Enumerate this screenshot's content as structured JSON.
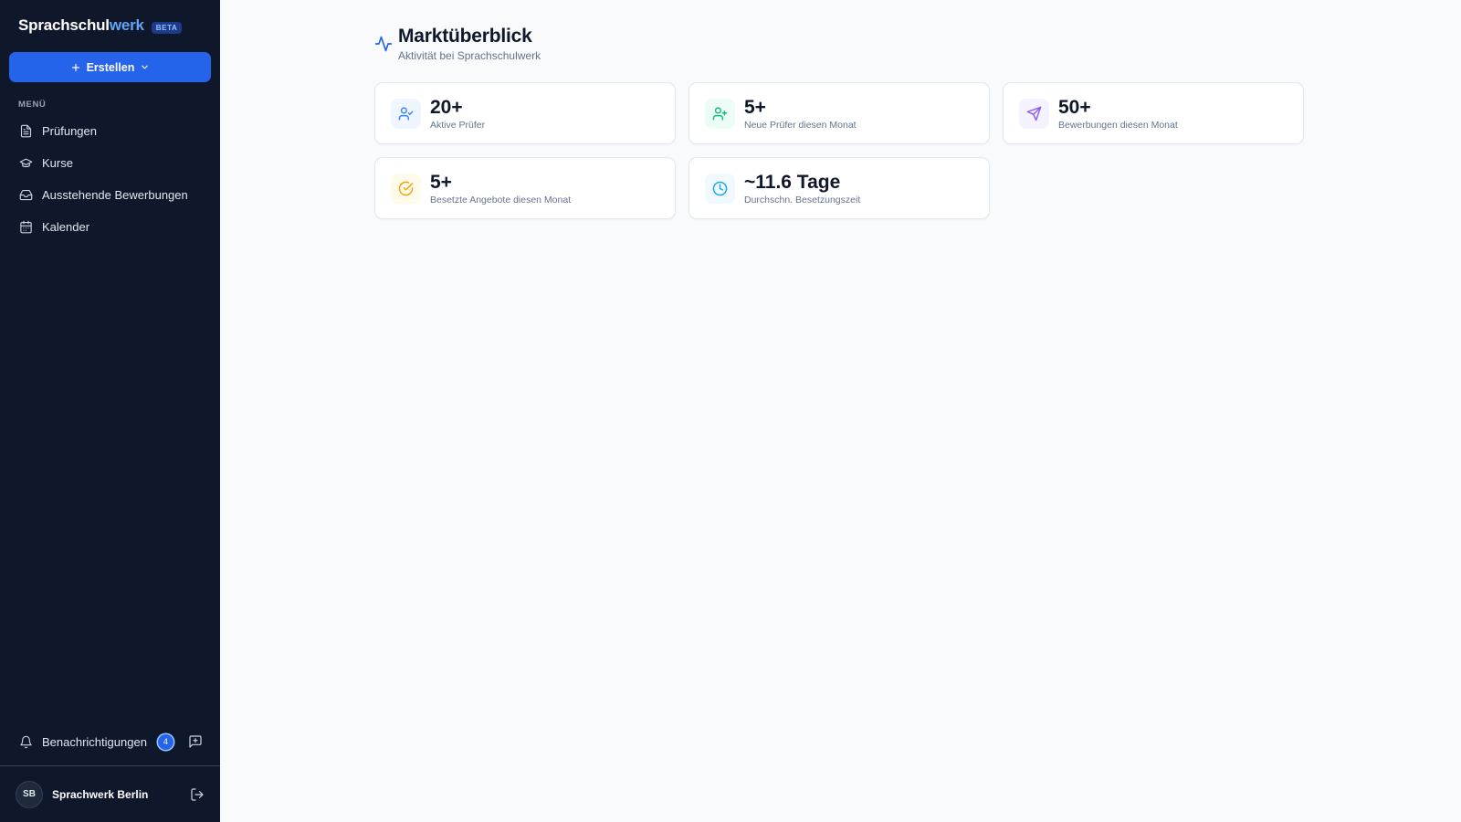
{
  "brand": {
    "name_part1": "Sprachschul",
    "name_part2": "werk",
    "badge": "BETA"
  },
  "create_button": {
    "label": "Erstellen",
    "icon": "plus-icon",
    "caret_icon": "chevron-down-icon"
  },
  "menu": {
    "title": "MENÜ",
    "items": [
      {
        "label": "Prüfungen",
        "icon": "file-text-icon"
      },
      {
        "label": "Kurse",
        "icon": "graduation-cap-icon"
      },
      {
        "label": "Ausstehende Bewerbungen",
        "icon": "inbox-icon"
      },
      {
        "label": "Kalender",
        "icon": "calendar-icon"
      }
    ]
  },
  "notifications": {
    "label": "Benachrichtigungen",
    "count": "4",
    "icon": "bell-icon",
    "feedback_icon": "message-square-plus-icon"
  },
  "user": {
    "initials": "SB",
    "name": "Sprachwerk Berlin",
    "logout_icon": "log-out-icon"
  },
  "header": {
    "title": "Marktüberblick",
    "subtitle": "Aktivität bei Sprachschulwerk",
    "icon": "activity-icon"
  },
  "stats": [
    {
      "value": "20+",
      "label": "Aktive Prüfer",
      "icon": "user-check-icon",
      "color": "#3b82f6",
      "bg": "#eff6ff"
    },
    {
      "value": "5+",
      "label": "Neue Prüfer diesen Monat",
      "icon": "user-plus-icon",
      "color": "#10b981",
      "bg": "#ecfdf5"
    },
    {
      "value": "50+",
      "label": "Bewerbungen diesen Monat",
      "icon": "send-icon",
      "color": "#8b5cf6",
      "bg": "#f5f3ff"
    },
    {
      "value": "5+",
      "label": "Besetzte Angebote diesen Monat",
      "icon": "circle-check-icon",
      "color": "#f59e0b",
      "bg": "#fffbeb"
    },
    {
      "value": "~11.6 Tage",
      "label": "Durchschn. Besetzungszeit",
      "icon": "clock-icon",
      "color": "#0ea5e9",
      "bg": "#f0f9ff"
    }
  ],
  "colors": {
    "sidebar": "#0f172a",
    "accent": "#2563eb",
    "brand_accent": "#60a5fa",
    "background": "#f8fafc"
  }
}
